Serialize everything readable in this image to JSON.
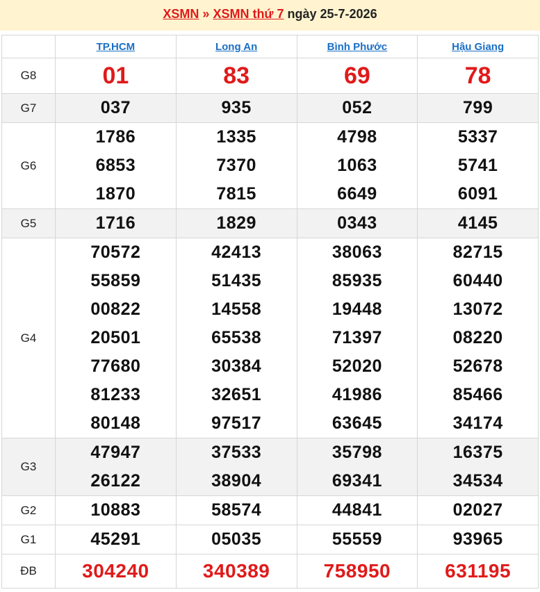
{
  "header": {
    "link1": "XSMN",
    "separator": "»",
    "link2": "XSMN thứ 7",
    "date_text": "ngày 25-7-2026"
  },
  "provinces": [
    "TP.HCM",
    "Long An",
    "Bình Phước",
    "Hậu Giang"
  ],
  "prizes": [
    {
      "label": "G8",
      "values": [
        [
          "01"
        ],
        [
          "83"
        ],
        [
          "69"
        ],
        [
          "78"
        ]
      ]
    },
    {
      "label": "G7",
      "values": [
        [
          "037"
        ],
        [
          "935"
        ],
        [
          "052"
        ],
        [
          "799"
        ]
      ]
    },
    {
      "label": "G6",
      "values": [
        [
          "1786",
          "6853",
          "1870"
        ],
        [
          "1335",
          "7370",
          "7815"
        ],
        [
          "4798",
          "1063",
          "6649"
        ],
        [
          "5337",
          "5741",
          "6091"
        ]
      ]
    },
    {
      "label": "G5",
      "values": [
        [
          "1716"
        ],
        [
          "1829"
        ],
        [
          "0343"
        ],
        [
          "4145"
        ]
      ]
    },
    {
      "label": "G4",
      "values": [
        [
          "70572",
          "55859",
          "00822",
          "20501",
          "77680",
          "81233",
          "80148"
        ],
        [
          "42413",
          "51435",
          "14558",
          "65538",
          "30384",
          "32651",
          "97517"
        ],
        [
          "38063",
          "85935",
          "19448",
          "71397",
          "52020",
          "41986",
          "63645"
        ],
        [
          "82715",
          "60440",
          "13072",
          "08220",
          "52678",
          "85466",
          "34174"
        ]
      ]
    },
    {
      "label": "G3",
      "values": [
        [
          "47947",
          "26122"
        ],
        [
          "37533",
          "38904"
        ],
        [
          "35798",
          "69341"
        ],
        [
          "16375",
          "34534"
        ]
      ]
    },
    {
      "label": "G2",
      "values": [
        [
          "10883"
        ],
        [
          "58574"
        ],
        [
          "44841"
        ],
        [
          "02027"
        ]
      ]
    },
    {
      "label": "G1",
      "values": [
        [
          "45291"
        ],
        [
          "05035"
        ],
        [
          "55559"
        ],
        [
          "93965"
        ]
      ]
    },
    {
      "label": "ĐB",
      "values": [
        [
          "304240"
        ],
        [
          "340389"
        ],
        [
          "758950"
        ],
        [
          "631195"
        ]
      ]
    }
  ],
  "colors": {
    "accent_red": "#e01a1a",
    "link_blue": "#1a6fc4",
    "header_bg": "#fff4cf",
    "alt_row_bg": "#f2f2f2"
  }
}
